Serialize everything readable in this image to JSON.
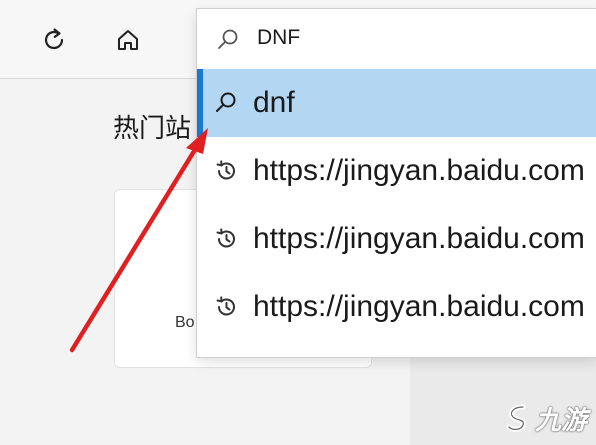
{
  "toolbar": {
    "refresh_icon": "refresh-icon",
    "home_icon": "home-icon"
  },
  "page": {
    "hot_title": "热门站",
    "tile_label": "Bo"
  },
  "search": {
    "value": "DNF",
    "icon": "search-icon"
  },
  "suggestions": [
    {
      "text": "dnf",
      "icon": "search-icon",
      "selected": true
    },
    {
      "text": "https://jingyan.baidu.com",
      "icon": "history-icon",
      "selected": false
    },
    {
      "text": "https://jingyan.baidu.com",
      "icon": "history-icon",
      "selected": false
    },
    {
      "text": "https://jingyan.baidu.com",
      "icon": "history-icon",
      "selected": false
    }
  ],
  "annotation": {
    "arrow_color": "#e02020"
  },
  "watermark": {
    "text": "九游",
    "logo": "jiuyou-logo"
  },
  "colors": {
    "selected_bg": "#b3d6f2",
    "accent": "#1b78d0"
  }
}
